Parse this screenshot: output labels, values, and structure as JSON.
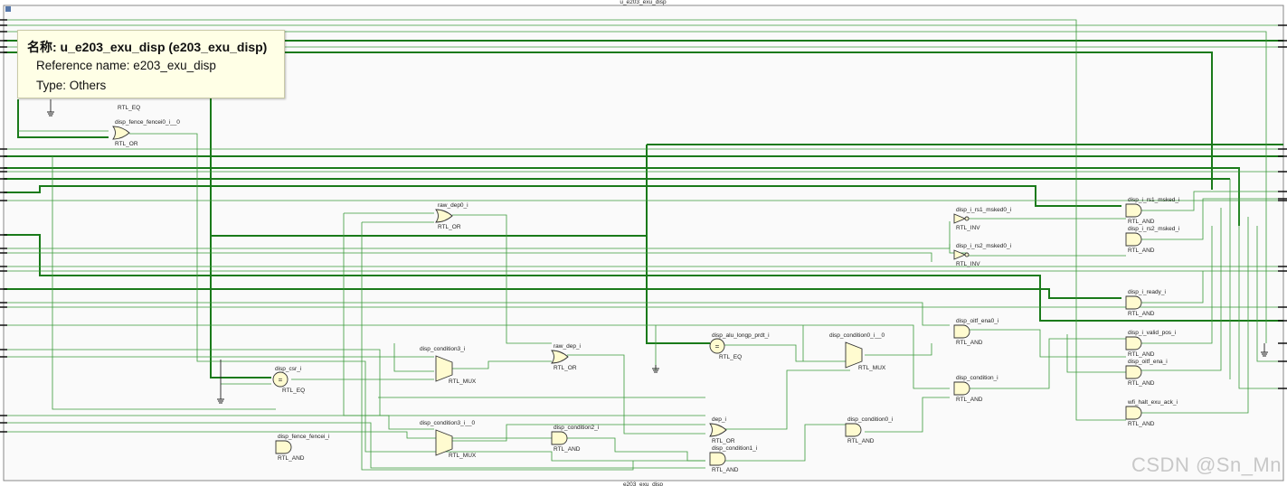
{
  "module": {
    "top_label": "u_e203_exu_disp",
    "bottom_label": "e203_exu_disp"
  },
  "tooltip": {
    "title": "名称: u_e203_exu_disp (e203_exu_disp)",
    "reference_name": "Reference name: e203_exu_disp",
    "type": "Type: Others"
  },
  "colors": {
    "wire": "#3a9a3a",
    "bus": "#1a7a1a",
    "gate_fill": "#fffbd0",
    "tooltip_bg": "#ffffe6"
  },
  "cells": [
    {
      "id": "c0",
      "name": "",
      "type": "RTL_EQ",
      "shape": "eq-hidden"
    },
    {
      "id": "c1",
      "name": "disp_fence_fencei0_i__0",
      "type": "RTL_OR",
      "shape": "or"
    },
    {
      "id": "c2",
      "name": "raw_dep0_i",
      "type": "RTL_OR",
      "shape": "or"
    },
    {
      "id": "c3",
      "name": "disp_i_rs1_msked0_i",
      "type": "RTL_INV",
      "shape": "inv"
    },
    {
      "id": "c4",
      "name": "disp_i_rs2_msked0_i",
      "type": "RTL_INV",
      "shape": "inv"
    },
    {
      "id": "c5",
      "name": "disp_i_rs1_msked_i",
      "type": "RTL_AND",
      "shape": "and"
    },
    {
      "id": "c6",
      "name": "disp_i_rs2_msked_i",
      "type": "RTL_AND",
      "shape": "and"
    },
    {
      "id": "c7",
      "name": "disp_i_ready_i",
      "type": "RTL_AND",
      "shape": "and"
    },
    {
      "id": "c8",
      "name": "disp_oitf_ena0_i",
      "type": "RTL_AND",
      "shape": "and"
    },
    {
      "id": "c9",
      "name": "disp_i_valid_pos_i",
      "type": "RTL_AND",
      "shape": "and"
    },
    {
      "id": "c10",
      "name": "disp_oitf_ena_i",
      "type": "RTL_AND",
      "shape": "and"
    },
    {
      "id": "c11",
      "name": "disp_condition_i",
      "type": "RTL_AND",
      "shape": "and"
    },
    {
      "id": "c12",
      "name": "wfi_halt_exu_ack_i",
      "type": "RTL_AND",
      "shape": "and"
    },
    {
      "id": "c13",
      "name": "disp_alu_longp_prdt_i",
      "type": "RTL_EQ",
      "shape": "eq"
    },
    {
      "id": "c14",
      "name": "disp_condition0_i__0",
      "type": "RTL_MUX",
      "shape": "mux"
    },
    {
      "id": "c15",
      "name": "disp_condition3_i",
      "type": "RTL_MUX",
      "shape": "mux"
    },
    {
      "id": "c16",
      "name": "raw_dep_i",
      "type": "RTL_OR",
      "shape": "or"
    },
    {
      "id": "c17",
      "name": "disp_csr_i",
      "type": "RTL_EQ",
      "shape": "eq"
    },
    {
      "id": "c18",
      "name": "disp_condition3_i__0",
      "type": "RTL_MUX",
      "shape": "mux"
    },
    {
      "id": "c19",
      "name": "disp_condition2_i",
      "type": "RTL_AND",
      "shape": "and"
    },
    {
      "id": "c20",
      "name": "dep_i",
      "type": "RTL_OR",
      "shape": "or"
    },
    {
      "id": "c21",
      "name": "disp_condition0_i",
      "type": "RTL_AND",
      "shape": "and"
    },
    {
      "id": "c22",
      "name": "disp_condition1_i",
      "type": "RTL_AND",
      "shape": "and"
    },
    {
      "id": "c23",
      "name": "disp_fence_fencei_i",
      "type": "RTL_AND",
      "shape": "and"
    }
  ],
  "watermark": "CSDN @Sn_Mn"
}
